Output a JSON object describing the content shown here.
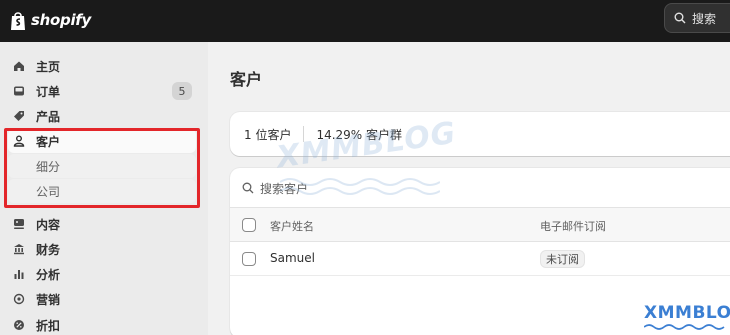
{
  "topbar": {
    "brand": "shopify",
    "search_label": "搜索"
  },
  "sidebar": {
    "items": [
      {
        "label": "主页",
        "icon": "home-icon"
      },
      {
        "label": "订单",
        "icon": "inbox-icon",
        "badge": "5"
      },
      {
        "label": "产品",
        "icon": "tag-icon"
      },
      {
        "label": "客户",
        "icon": "person-icon",
        "active": true
      },
      {
        "label": "内容",
        "icon": "content-icon"
      },
      {
        "label": "财务",
        "icon": "bank-icon"
      },
      {
        "label": "分析",
        "icon": "bar-chart-icon"
      },
      {
        "label": "营销",
        "icon": "target-icon"
      },
      {
        "label": "折扣",
        "icon": "discount-icon"
      }
    ],
    "sub_items": [
      {
        "label": "细分"
      },
      {
        "label": "公司"
      }
    ]
  },
  "main": {
    "title": "客户",
    "stats": {
      "customer_count": "1 位客户",
      "segment_percent": "14.29% 客户群"
    },
    "search_placeholder": "搜索客户",
    "table": {
      "columns": [
        "客户姓名",
        "电子邮件订阅"
      ],
      "rows": [
        {
          "name": "Samuel",
          "subscription": "未订阅"
        }
      ]
    }
  },
  "watermark": {
    "text": "XMMBLOG",
    "color": "#3b7fd3"
  },
  "colors": {
    "topbar_bg": "#1a1a1a",
    "highlight_border": "#e3262a",
    "sidebar_bg": "#ebebeb",
    "main_bg": "#f1f1f1"
  }
}
